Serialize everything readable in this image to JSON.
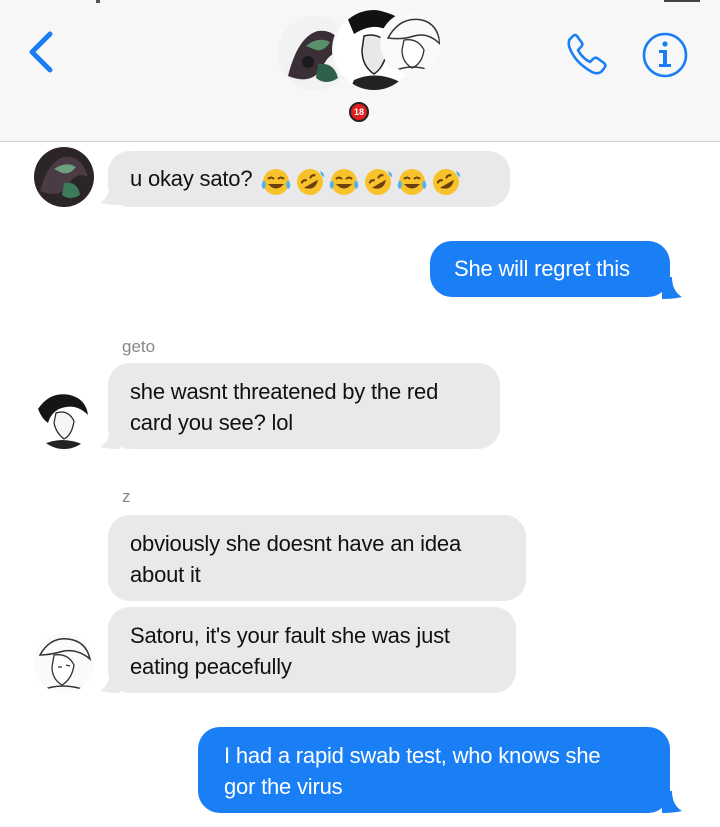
{
  "header": {
    "back_icon": "chevron-left-icon",
    "phone_icon": "phone-icon",
    "info_icon": "info-icon",
    "age_badge": "18",
    "accent_color": "#1a7ff5"
  },
  "messages": [
    {
      "direction": "incoming",
      "sender": "",
      "text": "u okay sato?",
      "emojis": [
        "face-with-tears-of-joy",
        "rolling-on-floor-laughing",
        "face-with-tears-of-joy",
        "rolling-on-floor-laughing",
        "face-with-tears-of-joy",
        "rolling-on-floor-laughing"
      ]
    },
    {
      "direction": "outgoing",
      "text": "She will regret this"
    },
    {
      "direction": "incoming",
      "sender": "geto",
      "text_lines": [
        "she wasnt threatened by the red",
        "card you see? lol"
      ]
    },
    {
      "direction": "incoming",
      "sender": "z",
      "text_lines": [
        "obviously she doesnt have an idea",
        "about it"
      ]
    },
    {
      "direction": "incoming",
      "sender": "",
      "text_lines": [
        "Satoru, it's your fault she was just",
        "eating peacefully"
      ]
    },
    {
      "direction": "outgoing",
      "text_lines": [
        "I had a rapid swab test, who knows she",
        "gor the virus"
      ]
    }
  ],
  "colors": {
    "incoming_bubble": "#e9e9eb",
    "outgoing_bubble": "#1a7ff5"
  }
}
